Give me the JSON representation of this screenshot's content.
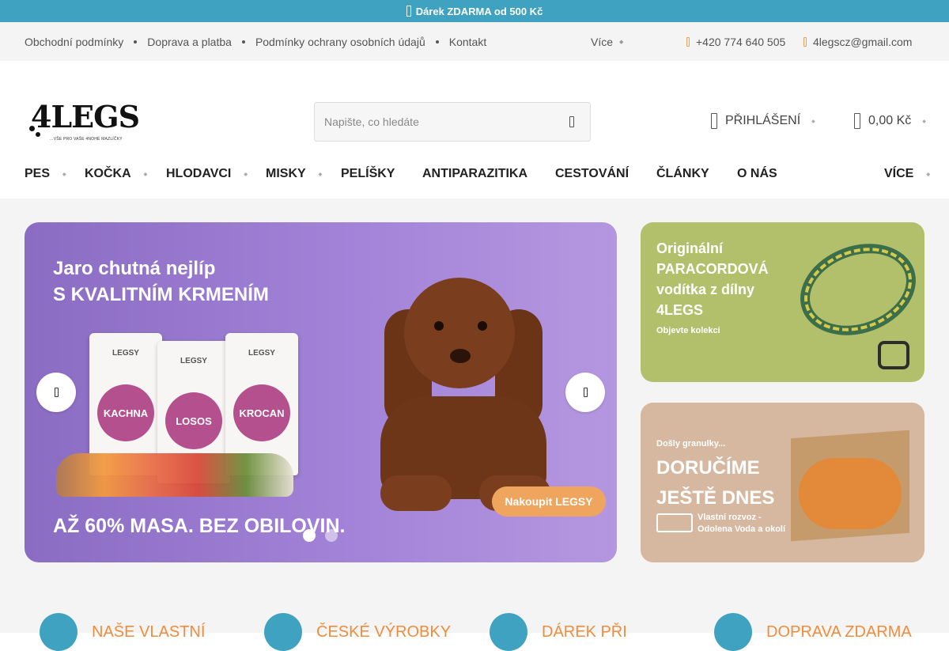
{
  "promo": {
    "text": "Dárek ZDARMA od 500 Kč",
    "icon": "gift-icon"
  },
  "topbar": {
    "links": [
      "Obchodní podmínky",
      "Doprava a platba",
      "Podmínky ochrany osobních údajů",
      "Kontakt"
    ],
    "more_label": "Více",
    "phone": "+420 774 640 505",
    "email": "4legscz@gmail.com"
  },
  "header": {
    "logo_text": "4LEGS",
    "logo_tagline": "...VŠE PRO VAŠE 4NOHÉ MAZLÍČKY",
    "search_placeholder": "Napište, co hledáte",
    "login_label": "PŘIHLÁŠENÍ",
    "cart_total": "0,00 Kč"
  },
  "nav": {
    "items": [
      {
        "label": "PES",
        "has_dropdown": true
      },
      {
        "label": "KOČKA",
        "has_dropdown": true
      },
      {
        "label": "HLODAVCI",
        "has_dropdown": true
      },
      {
        "label": "MISKY",
        "has_dropdown": true
      },
      {
        "label": "PELÍŠKY",
        "has_dropdown": false
      },
      {
        "label": "ANTIPARAZITIKA",
        "has_dropdown": false
      },
      {
        "label": "CESTOVÁNÍ",
        "has_dropdown": false
      },
      {
        "label": "ČLÁNKY",
        "has_dropdown": false
      },
      {
        "label": "O NÁS",
        "has_dropdown": false
      }
    ],
    "more_label": "VÍCE"
  },
  "hero": {
    "headline_1": "Jaro chutná nejlíp",
    "headline_2": "S KVALITNÍM KRMENÍM",
    "bottom_text": "AŽ 60% MASA. BEZ OBILOVIN.",
    "cta": "Nakoupit LEGSY",
    "bags": [
      {
        "brand": "LEGSY",
        "flavor": "KACHNA"
      },
      {
        "brand": "LEGSY",
        "flavor": "LOSOS"
      },
      {
        "brand": "LEGSY",
        "flavor": "KROCAN"
      }
    ],
    "slides_count": 2,
    "active_slide": 1
  },
  "banner1": {
    "line1": "Originální",
    "line2": "PARACORDOVÁ",
    "line3": "vodítka z dílny",
    "line4": "4LEGS",
    "sub": "Objevte kolekci"
  },
  "banner2": {
    "pre": "Došly granulky...",
    "line1": "DORUČÍME",
    "line2": "JEŠTĚ DNES",
    "sub1": "Vlastní rozvoz -",
    "sub2": "Odolena Voda a okolí"
  },
  "features": [
    "NAŠE VLASTNÍ",
    "ČESKÉ VÝROBKY",
    "DÁREK PŘI",
    "DOPRAVA ZDARMA"
  ],
  "colors": {
    "accent": "#3fa2c0",
    "orange": "#f08c3c",
    "hero_bg": "#a283d8"
  }
}
